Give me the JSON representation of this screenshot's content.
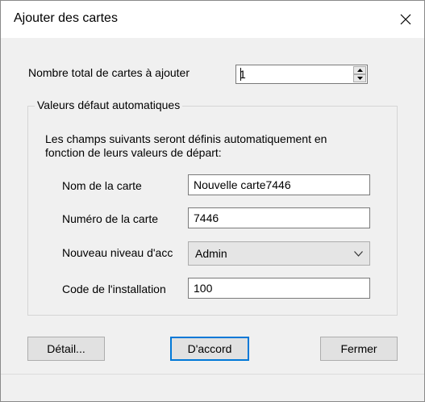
{
  "window": {
    "title": "Ajouter des cartes"
  },
  "count": {
    "label": "Nombre total de cartes à ajouter",
    "value": "1"
  },
  "defaults_group": {
    "legend": "Valeurs  défaut automatiques",
    "description_line1": "Les champs suivants seront définis automatiquement en",
    "description_line2": "fonction de leurs valeurs de départ:"
  },
  "fields": {
    "card_name": {
      "label": "Nom de la carte",
      "value": "Nouvelle carte7446"
    },
    "card_number": {
      "label": "Numéro de la carte",
      "value": "7446"
    },
    "access_level": {
      "label": "Nouveau niveau d'acc",
      "value": "Admin"
    },
    "facility_code": {
      "label": "Code de l'installation",
      "value": "100"
    }
  },
  "buttons": {
    "detail": "Détail...",
    "ok": "D'accord",
    "close": "Fermer"
  },
  "icons": [
    "close-icon",
    "arrow-up-icon",
    "arrow-down-icon",
    "chevron-down-icon"
  ],
  "colors": {
    "default_button_border": "#0078d7",
    "dialog_background": "#f0f0f0"
  }
}
